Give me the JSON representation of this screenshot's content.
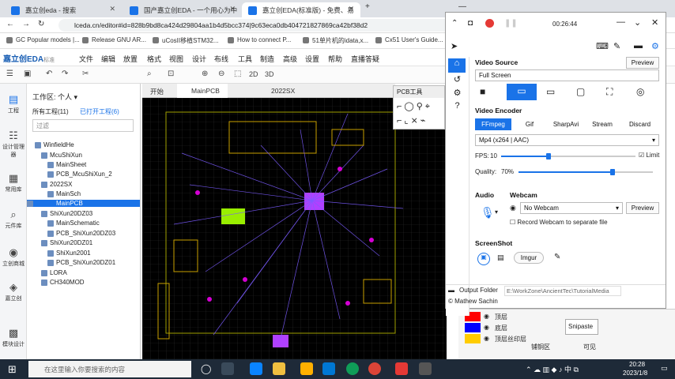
{
  "browser": {
    "tabs": [
      "嘉立创eda - 搜索",
      "国产嘉立创EDA - 一个用心为中",
      "嘉立创EDA(标准版) - 免费、易"
    ],
    "new_tab": "+",
    "url": "lceda.cn/editor#id=828b9bd8ca424d29804aa1b4d5bcc374|9c63eca0db404721827869ca42bf38d2"
  },
  "bookmarks": [
    "GC  Popular models |...",
    "Release GNU AR...",
    "uCosII移植STM32...",
    "How to connect P...",
    "51单片机的idata,x...",
    "Cx51 User's Guide..."
  ],
  "app": {
    "logo": "嘉立创EDA",
    "logo_suffix": "标准",
    "menu": [
      "文件",
      "编辑",
      "放置",
      "格式",
      "视图",
      "设计",
      "布线",
      "工具",
      "制造",
      "高级",
      "设置",
      "帮助",
      "直播答疑"
    ],
    "toolbar_2d": "2D",
    "toolbar_3d": "3D"
  },
  "rail": [
    "工程",
    "设计管理器",
    "常用库",
    "元件库",
    "立创商城",
    "嘉立创",
    "模块设计"
  ],
  "panel": {
    "workspace": "工作区: 个人",
    "all_projects": "所有工程(11)",
    "open_projects": "已打开工程(6)",
    "filter_placeholder": "过滤",
    "items": [
      "WinfieldHe",
      "McuShiXun",
      "MainSheet",
      "PCB_McuShiXun_2",
      "2022SX",
      "MainSch",
      "MainPCB",
      "ShiXun20DZ03",
      "MainSchematic",
      "PCB_ShiXun20DZ03",
      "ShiXun20DZ01",
      "ShiXun2001",
      "PCB_ShiXun20DZ01",
      "LORA",
      "CH340MOD"
    ]
  },
  "editor": {
    "tabs": [
      "开始",
      "MainPCB",
      "2022SX"
    ],
    "pcb_tool": "PCB工具"
  },
  "recorder": {
    "time": "00:26:44",
    "video_source": "Video Source",
    "preview": "Preview",
    "source_value": "Full Screen",
    "video_encoder": "Video Encoder",
    "encoders": [
      "FFmpeg",
      "Gif",
      "SharpAvi",
      "Stream",
      "Discard"
    ],
    "codec": "Mp4 (x264 | AAC)",
    "fps_label": "FPS:",
    "fps": "10",
    "limit": "Limit",
    "quality_label": "Quality:",
    "quality": "70%",
    "audio": "Audio",
    "webcam": "Webcam",
    "webcam_value": "No Webcam",
    "webcam_preview": "Preview",
    "record_separate": "Record Webcam to separate file",
    "screenshot": "ScreenShot",
    "imgur": "Imgur",
    "output_folder": "Output Folder",
    "output_path": "E:\\WorkZone\\AncientTec\\TutorialMedia",
    "author": "© Mathew Sachin",
    "fps_fraction": 0.35,
    "quality_fraction": 0.7
  },
  "layers": {
    "rows": [
      "顶层",
      "底层",
      "顶层丝印层"
    ],
    "right_label": "铺铜区",
    "right_value": "可见"
  },
  "snipaste": "Snipaste",
  "taskbar": {
    "search": "在这里输入你要搜索的内容",
    "time": "20:28",
    "date": "2023/1/8"
  },
  "colors": {
    "accent": "#1a73e8",
    "canvas": "#000000",
    "trace_purple": "#7b5cff",
    "layer_red": "#ff0000",
    "layer_blue": "#0000ff",
    "layer_yellow": "#ffcc00"
  }
}
